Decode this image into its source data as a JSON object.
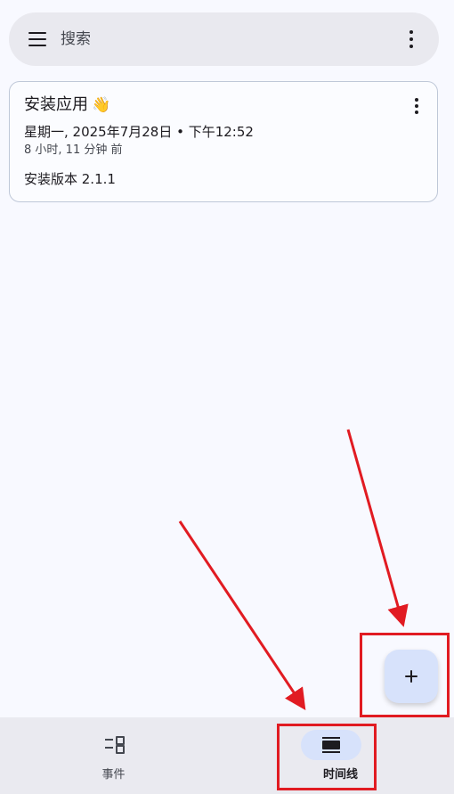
{
  "search": {
    "placeholder": "搜索",
    "menu_icon": "menu-icon",
    "more_icon": "more-vert-icon"
  },
  "event_card": {
    "title": "安装应用",
    "emoji": "👋",
    "datetime": "星期一, 2025年7月28日 • 下午12:52",
    "relative": "8 小时, 11 分钟 前",
    "note": "安装版本 2.1.1",
    "more_icon": "more-vert-icon"
  },
  "fab": {
    "icon": "plus-icon"
  },
  "bottom_nav": {
    "items": [
      {
        "label": "事件",
        "icon": "events-icon",
        "active": false
      },
      {
        "label": "时间线",
        "icon": "timeline-icon",
        "active": true
      }
    ]
  },
  "annotation": {
    "color": "#e11b22"
  },
  "colors": {
    "background": "#f8f9ff",
    "search_bar": "#e9e9ef",
    "accent_container": "#d7e2fb",
    "card_border": "#bfc8d8"
  }
}
